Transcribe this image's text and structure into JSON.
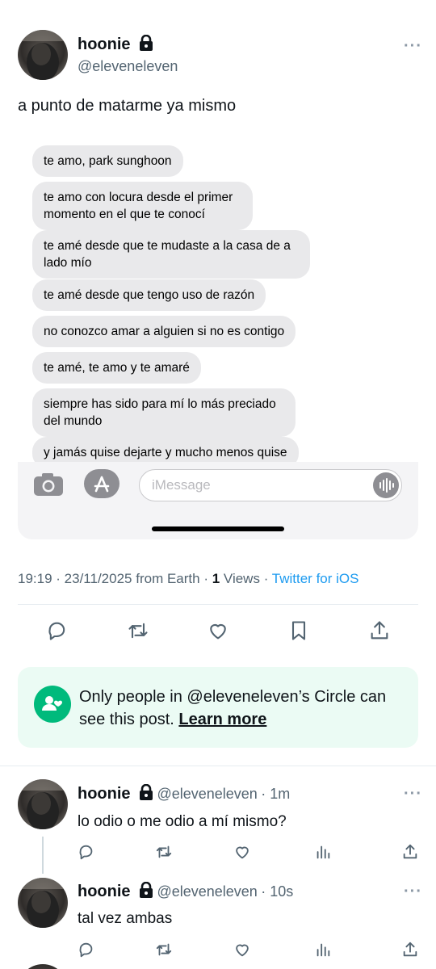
{
  "tweet": {
    "display_name": "hoonie",
    "handle": "@eleveneleven",
    "text": "a punto de matarme ya mismo",
    "more_label": "···"
  },
  "screenshot": {
    "bubbles": [
      "te amo, park sunghoon",
      "te amo con locura desde el primer momento en el que te conocí",
      "te amé desde que te mudaste a la casa de a lado mío",
      "te amé desde que tengo uso de razón",
      "no conozco amar a alguien si no es contigo",
      "te amé, te amo y te amaré",
      "siempre has sido para mí lo más preciado del mundo",
      "y jamás quise dejarte y mucho menos quise"
    ],
    "input_placeholder": "iMessage"
  },
  "meta": {
    "time": "19:19",
    "date": "23/11/2025",
    "location": "from Earth",
    "views_count": "1",
    "views_label": "Views",
    "source": "Twitter for iOS"
  },
  "circle": {
    "text_before": "Only people in @eleveneleven’s Circle can see this post.",
    "learn_more": "Learn more"
  },
  "replies": [
    {
      "display_name": "hoonie",
      "handle": "@eleveneleven",
      "time": "1m",
      "text": "lo odio o me odio a mí mismo?"
    },
    {
      "display_name": "hoonie",
      "handle": "@eleveneleven",
      "time": "10s",
      "text": "tal vez ambas"
    }
  ],
  "colors": {
    "accent": "#1d9bf0",
    "circle_green": "#00ba7c",
    "circle_bg": "#ebfbf4",
    "bubble_gray": "#e9e9eb"
  }
}
